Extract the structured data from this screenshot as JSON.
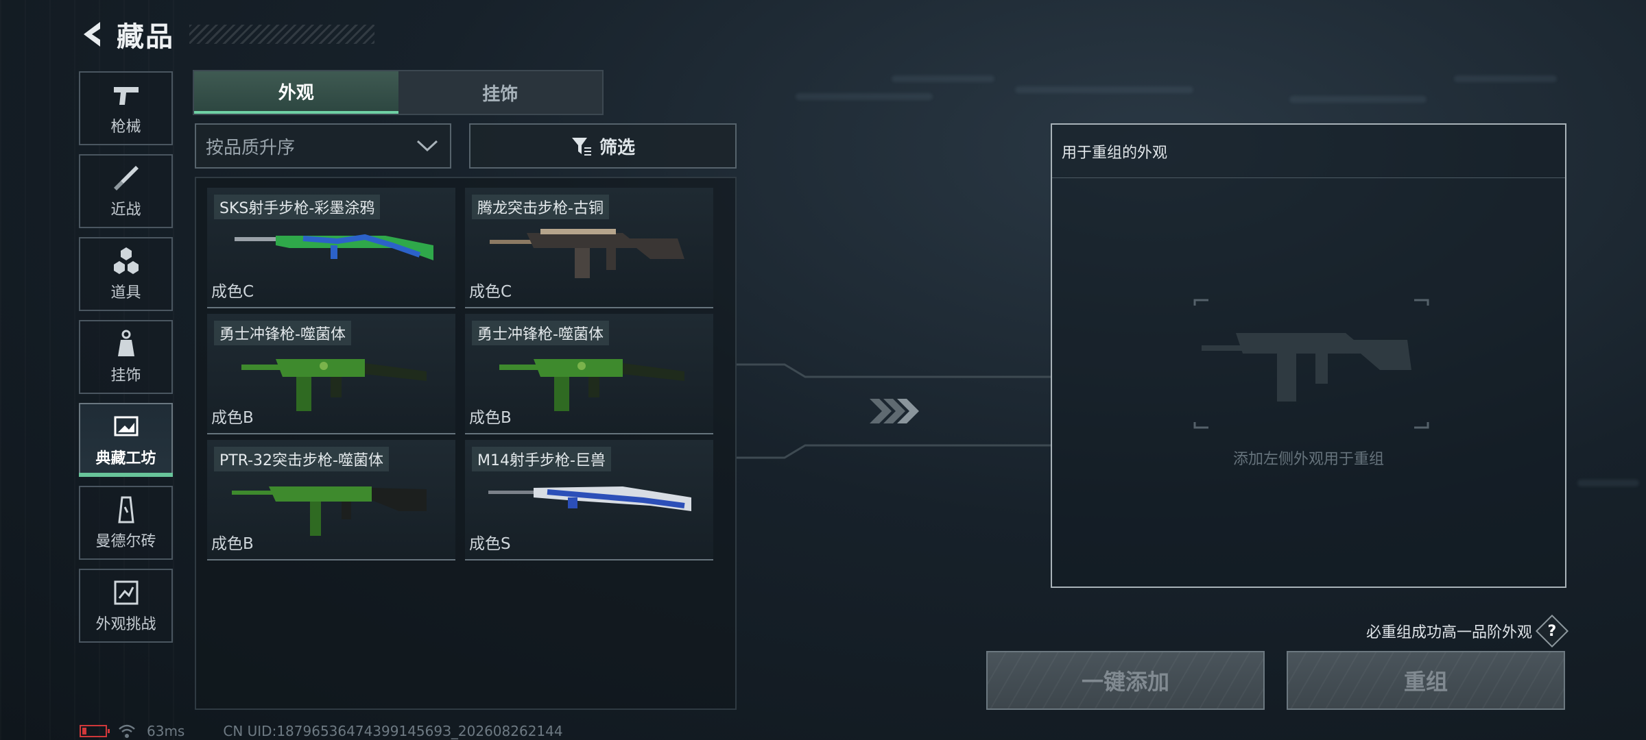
{
  "header": {
    "title": "藏品"
  },
  "nav": {
    "items": [
      {
        "label": "枪械",
        "icon": "pistol-icon"
      },
      {
        "label": "近战",
        "icon": "knife-icon"
      },
      {
        "label": "道具",
        "icon": "cubes-icon"
      },
      {
        "label": "挂饰",
        "icon": "charm-icon"
      },
      {
        "label": "典藏工坊",
        "icon": "workshop-icon",
        "active": true
      },
      {
        "label": "曼德尔砖",
        "icon": "brick-icon"
      },
      {
        "label": "外观挑战",
        "icon": "challenge-icon"
      }
    ]
  },
  "tabs": [
    {
      "label": "外观",
      "active": true
    },
    {
      "label": "挂饰",
      "active": false
    }
  ],
  "sort": {
    "label": "按品质升序"
  },
  "filter": {
    "label": "筛选"
  },
  "items": [
    {
      "name": "SKS射手步枪-彩墨涂鸦",
      "grade": "成色C",
      "colors": [
        "#2fa84a",
        "#2c62c9",
        "#9aa1a8"
      ]
    },
    {
      "name": "腾龙突击步枪-古铜",
      "grade": "成色C",
      "colors": [
        "#8c7a63",
        "#3a3634",
        "#b6a58c"
      ]
    },
    {
      "name": "勇士冲锋枪-噬菌体",
      "grade": "成色B",
      "colors": [
        "#3e8a2d",
        "#1f2b1c",
        "#7ab34b"
      ]
    },
    {
      "name": "勇士冲锋枪-噬菌体",
      "grade": "成色B",
      "colors": [
        "#3e8a2d",
        "#1f2b1c",
        "#7ab34b"
      ]
    },
    {
      "name": "PTR-32突击步枪-噬菌体",
      "grade": "成色B",
      "colors": [
        "#3e8a2d",
        "#1c1f1e",
        "#7ab34b"
      ]
    },
    {
      "name": "M14射手步枪-巨兽",
      "grade": "成色S",
      "colors": [
        "#d8dde4",
        "#2c4fb8",
        "#7b8189"
      ]
    }
  ],
  "recombine": {
    "title": "用于重组的外观",
    "placeholder": "添加左侧外观用于重组",
    "note": "必重组成功高一品阶外观",
    "help": "?",
    "add_all": "一键添加",
    "recombine": "重组"
  },
  "status": {
    "ping": "63ms",
    "uid": "CN UID:1879653647439914569З_202608262144"
  },
  "colors": {
    "accent": "#6fd0a4",
    "danger": "#d0383a"
  }
}
